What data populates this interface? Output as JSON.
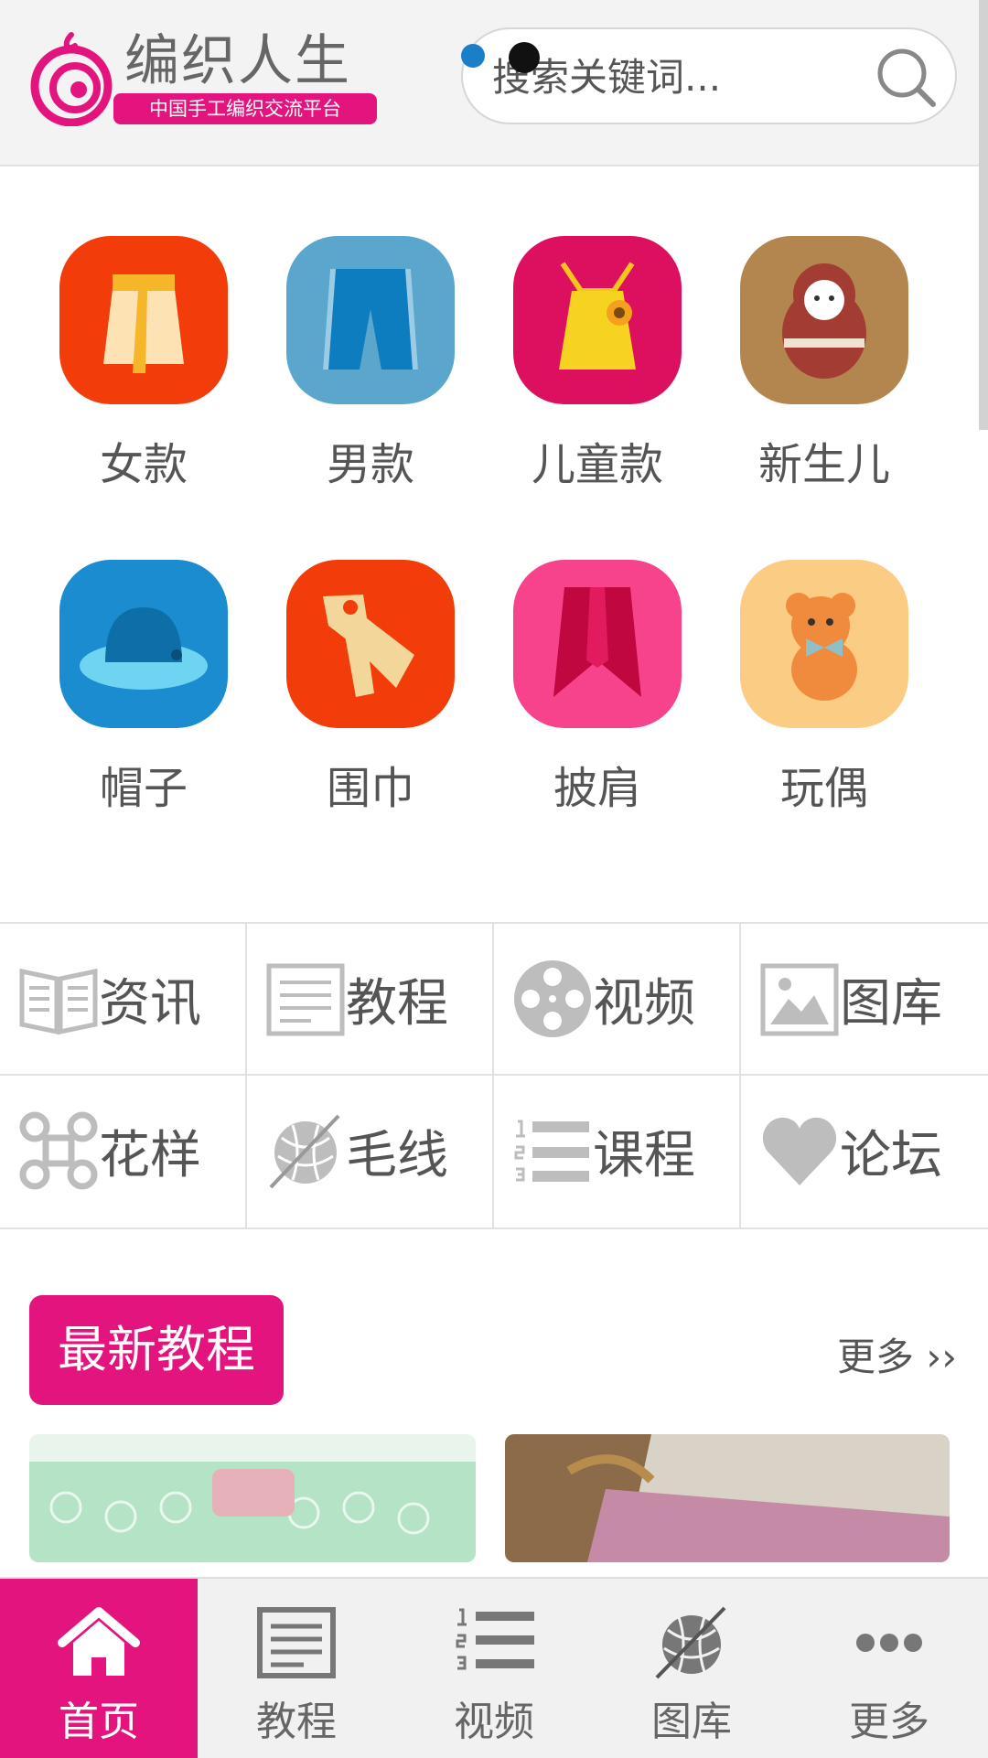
{
  "header": {
    "logo_title": "编织人生",
    "logo_subtitle": "中国手工编织交流平台",
    "search_placeholder": "搜索关键词..."
  },
  "categories": [
    {
      "label": "女款",
      "icon": "skirt-icon",
      "color": "#f23d0a"
    },
    {
      "label": "男款",
      "icon": "shorts-icon",
      "color": "#5aa6cc"
    },
    {
      "label": "儿童款",
      "icon": "child-top-icon",
      "color": "#dd1060"
    },
    {
      "label": "新生儿",
      "icon": "doll-icon",
      "color": "#b3864f"
    },
    {
      "label": "帽子",
      "icon": "hat-icon",
      "color": "#1a8ccf"
    },
    {
      "label": "围巾",
      "icon": "scarf-icon",
      "color": "#f23d0a"
    },
    {
      "label": "披肩",
      "icon": "shawl-icon",
      "color": "#f6438c"
    },
    {
      "label": "玩偶",
      "icon": "teddy-bear-icon",
      "color": "#fbcd84"
    }
  ],
  "nav_grid": [
    {
      "label": "资讯",
      "icon": "book-icon"
    },
    {
      "label": "教程",
      "icon": "document-icon"
    },
    {
      "label": "视频",
      "icon": "film-reel-icon"
    },
    {
      "label": "图库",
      "icon": "image-icon"
    },
    {
      "label": "花样",
      "icon": "command-icon"
    },
    {
      "label": "毛线",
      "icon": "yarn-ball-icon"
    },
    {
      "label": "课程",
      "icon": "numbered-list-icon"
    },
    {
      "label": "论坛",
      "icon": "heart-icon"
    }
  ],
  "latest": {
    "title": "最新教程",
    "more": "更多 ››"
  },
  "tabbar": [
    {
      "label": "首页",
      "icon": "home-icon",
      "active": true
    },
    {
      "label": "教程",
      "icon": "document-icon",
      "active": false
    },
    {
      "label": "视频",
      "icon": "numbered-list-icon",
      "active": false
    },
    {
      "label": "图库",
      "icon": "yarn-ball-icon",
      "active": false
    },
    {
      "label": "更多",
      "icon": "more-dots-icon",
      "active": false
    }
  ],
  "colors": {
    "brand": "#e4147e",
    "header_bg": "#f3f3f3",
    "icon_gray": "#bdbdbd"
  }
}
